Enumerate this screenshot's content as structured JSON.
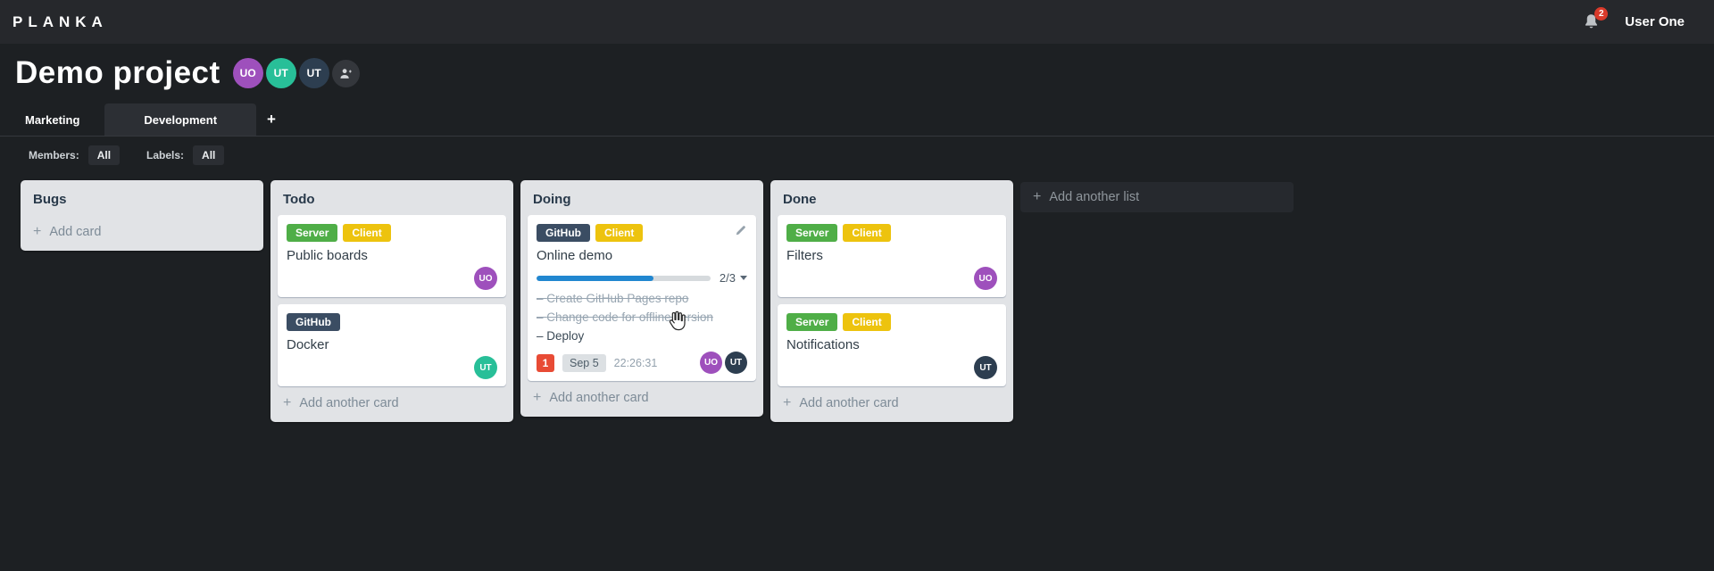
{
  "topbar": {
    "logo": "PLANKA",
    "notification_count": "2",
    "user_name": "User One"
  },
  "project": {
    "title": "Demo project",
    "members": [
      {
        "initials": "UO",
        "color": "#9e50bc"
      },
      {
        "initials": "UT",
        "color": "#28bf98"
      },
      {
        "initials": "UT",
        "color": "#2d3e50"
      }
    ]
  },
  "tabs": {
    "items": [
      {
        "label": "Marketing",
        "active": false
      },
      {
        "label": "Development",
        "active": true
      }
    ],
    "add_label": "+"
  },
  "filters": {
    "members_label": "Members:",
    "members_value": "All",
    "labels_label": "Labels:",
    "labels_value": "All"
  },
  "ui": {
    "plus": "+",
    "task_bullet": "–"
  },
  "board": {
    "add_list_label": "Add another list",
    "lists": [
      {
        "name": "Bugs",
        "add_card_label": "Add card",
        "cards": []
      },
      {
        "name": "Todo",
        "add_card_label": "Add another card",
        "cards": [
          {
            "title": "Public boards",
            "labels": [
              {
                "text": "Server",
                "color": "#4fae47"
              },
              {
                "text": "Client",
                "color": "#edc30e"
              }
            ],
            "members": [
              {
                "initials": "UO",
                "color": "#9e50bc"
              }
            ]
          },
          {
            "title": "Docker",
            "labels": [
              {
                "text": "GitHub",
                "color": "#3b4d63"
              }
            ],
            "members": [
              {
                "initials": "UT",
                "color": "#28bf98"
              }
            ]
          }
        ]
      },
      {
        "name": "Doing",
        "add_card_label": "Add another card",
        "cards": [
          {
            "title": "Online demo",
            "labels": [
              {
                "text": "GitHub",
                "color": "#3b4d63"
              },
              {
                "text": "Client",
                "color": "#edc30e"
              }
            ],
            "progress": {
              "label": "2/3",
              "percent": "67%"
            },
            "tasks": [
              {
                "text": "Create GitHub Pages repo",
                "completed": true
              },
              {
                "text": "Change code for offline version",
                "completed": true
              },
              {
                "text": "Deploy",
                "completed": false
              }
            ],
            "notification_count": "1",
            "due_date": "Sep 5",
            "time": "22:26:31",
            "members": [
              {
                "initials": "UO",
                "color": "#9e50bc"
              },
              {
                "initials": "UT",
                "color": "#2d3e50"
              }
            ]
          }
        ]
      },
      {
        "name": "Done",
        "add_card_label": "Add another card",
        "cards": [
          {
            "title": "Filters",
            "labels": [
              {
                "text": "Server",
                "color": "#4fae47"
              },
              {
                "text": "Client",
                "color": "#edc30e"
              }
            ],
            "members": [
              {
                "initials": "UO",
                "color": "#9e50bc"
              }
            ]
          },
          {
            "title": "Notifications",
            "labels": [
              {
                "text": "Server",
                "color": "#4fae47"
              },
              {
                "text": "Client",
                "color": "#edc30e"
              }
            ],
            "members": [
              {
                "initials": "UT",
                "color": "#2d3e50"
              }
            ]
          }
        ]
      }
    ]
  }
}
